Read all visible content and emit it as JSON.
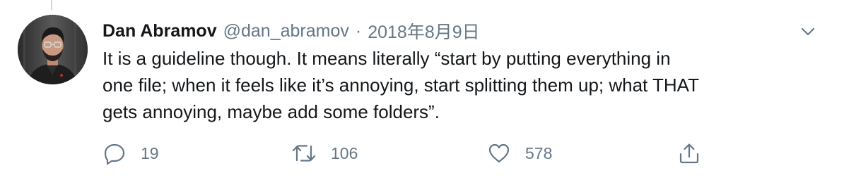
{
  "tweet": {
    "author": {
      "name": "Dan Abramov",
      "handle": "@dan_abramov"
    },
    "separator": "·",
    "date": "2018年8月9日",
    "text_lines": [
      "It is a guideline though. It means literally “start by putting everything in",
      "one file; when it feels like it’s annoying, start splitting them up; what THAT",
      "gets annoying, maybe add some folders”."
    ],
    "actions": {
      "reply_count": "19",
      "retweet_count": "106",
      "like_count": "578"
    }
  },
  "icons": {
    "reply": "reply-icon",
    "retweet": "retweet-icon",
    "like": "heart-icon",
    "share": "share-icon",
    "more": "chevron-down-icon"
  },
  "colors": {
    "text": "#14171a",
    "secondary": "#657786",
    "thread_line": "#ccd6dd"
  }
}
